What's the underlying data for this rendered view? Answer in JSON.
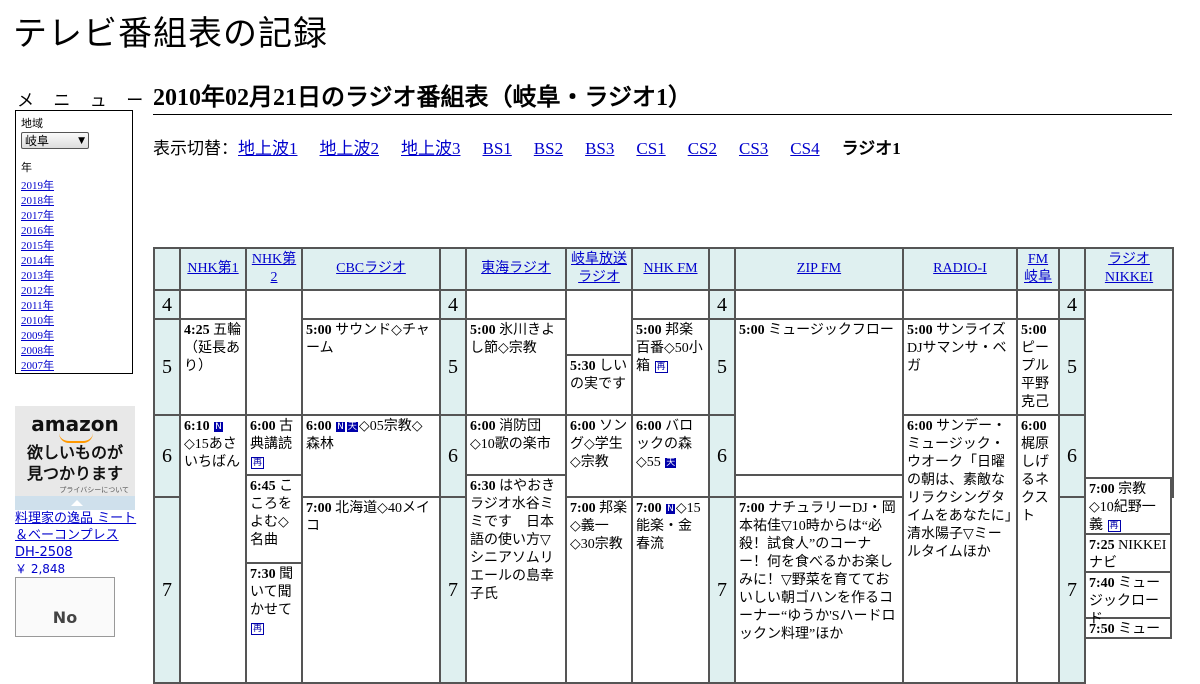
{
  "site": {
    "title": "テレビ番組表の記録"
  },
  "menu": {
    "heading": "メ ニ ュ ー",
    "region_label": "地域",
    "region_value": "岐阜",
    "year_label": "年",
    "years": [
      "2019年",
      "2018年",
      "2017年",
      "2016年",
      "2015年",
      "2014年",
      "2013年",
      "2012年",
      "2011年",
      "2010年",
      "2009年",
      "2008年",
      "2007年"
    ]
  },
  "ad": {
    "logo": "amazon",
    "tagline_1": "欲しいものが",
    "tagline_2": "見つかります",
    "privacy": "プライバシーについて",
    "product_name": "料理家の逸品 ミート＆ベーコンプレス DH-2508",
    "product_price": "￥ 2,848",
    "noimage": "No"
  },
  "page": {
    "heading": "2010年02月21日のラジオ番組表（岐阜・ラジオ1）",
    "switch_label": "表示切替：",
    "switch_links": [
      "地上波1",
      "地上波2",
      "地上波3",
      "BS1",
      "BS2",
      "BS3",
      "CS1",
      "CS2",
      "CS3",
      "CS4"
    ],
    "switch_current": "ラジオ1"
  },
  "grid": {
    "stations": [
      "NHK第1",
      "NHK第2",
      "CBCラジオ",
      "東海ラジオ",
      "岐阜放送ラジオ",
      "NHK FM",
      "ZIP FM",
      "RADIO-I",
      "FM岐阜",
      "ラジオNIKKEI"
    ],
    "hours": [
      "4",
      "5",
      "6",
      "7"
    ],
    "badges": {
      "n": "N",
      "ten": "天",
      "sai": "再"
    },
    "programs": {
      "nhk1_0425": {
        "time": "4:25",
        "title": "五輪（延長あり）"
      },
      "nhk1_0610": {
        "time": "6:10",
        "title": "◇15あさいちばん"
      },
      "nhk2_0600": {
        "time": "6:00",
        "title": "古典講読"
      },
      "nhk2_0645": {
        "time": "6:45",
        "title": "こころをよむ◇名曲"
      },
      "nhk2_0730": {
        "time": "7:30",
        "title": "聞いて聞かせて"
      },
      "cbc_0500": {
        "time": "5:00",
        "title": "サウンド◇チャーム"
      },
      "cbc_0600": {
        "time": "6:00",
        "title": "◇05宗教◇森林"
      },
      "cbc_0700": {
        "time": "7:00",
        "title": "北海道◇40メイコ"
      },
      "tokai_0500": {
        "time": "5:00",
        "title": "氷川きよし節◇宗教"
      },
      "tokai_0600": {
        "time": "6:00",
        "title": "消防団◇10歌の楽市"
      },
      "tokai_0630": {
        "time": "6:30",
        "title": "はやおきラジオ水谷ミミです　日本語の使い方▽シニアソムリエールの島幸子氏"
      },
      "gifu_0530": {
        "time": "5:30",
        "title": "しいの実です"
      },
      "gifu_0600": {
        "time": "6:00",
        "title": "ソング◇学生◇宗教"
      },
      "gifu_0700": {
        "time": "7:00",
        "title": "邦楽◇義一◇30宗教"
      },
      "fm_0500": {
        "time": "5:00",
        "title": "邦楽百番◇50小箱"
      },
      "fm_0600": {
        "time": "6:00",
        "title": "バロックの森◇55"
      },
      "fm_0700": {
        "time": "7:00",
        "title": "◇15能楽・金春流"
      },
      "zip_0500": {
        "time": "5:00",
        "title": "ミュージックフロー"
      },
      "zip_0700": {
        "time": "7:00",
        "title": "ナチュラリーDJ・岡本祐佳▽10時からは“必殺！試食人”のコーナー！何を食べるかお楽しみに！▽野菜を育てておいしい朝ゴハンを作るコーナー“ゆうか'Sハードロックン料理”ほか"
      },
      "radioi_0500": {
        "time": "5:00",
        "title": "サンライズDJサマンサ・ベガ"
      },
      "radioi_0600": {
        "time": "6:00",
        "title": "サンデー・ミュージック・ウオーク「日曜の朝は、素敵なリラクシングタイムをあなたに」清水陽子▽ミールタイムほか"
      },
      "fmgifu_0500": {
        "time": "5:00",
        "title": "ピープル平野克己"
      },
      "fmgifu_0600": {
        "time": "6:00",
        "title": "梶原しげるネクスト"
      },
      "nikkei_0700": {
        "time": "7:00",
        "title": "宗教◇10紀野一義"
      },
      "nikkei_0725": {
        "time": "7:25",
        "title": "NIKKEIナビ"
      },
      "nikkei_0740": {
        "time": "7:40",
        "title": "ミュージックロード"
      },
      "nikkei_0750": {
        "time": "7:50",
        "title": "ミュージ"
      }
    }
  },
  "colors": {
    "header_bg": "#dff0f0",
    "link": "#0000cc",
    "badge": "#0000aa"
  }
}
